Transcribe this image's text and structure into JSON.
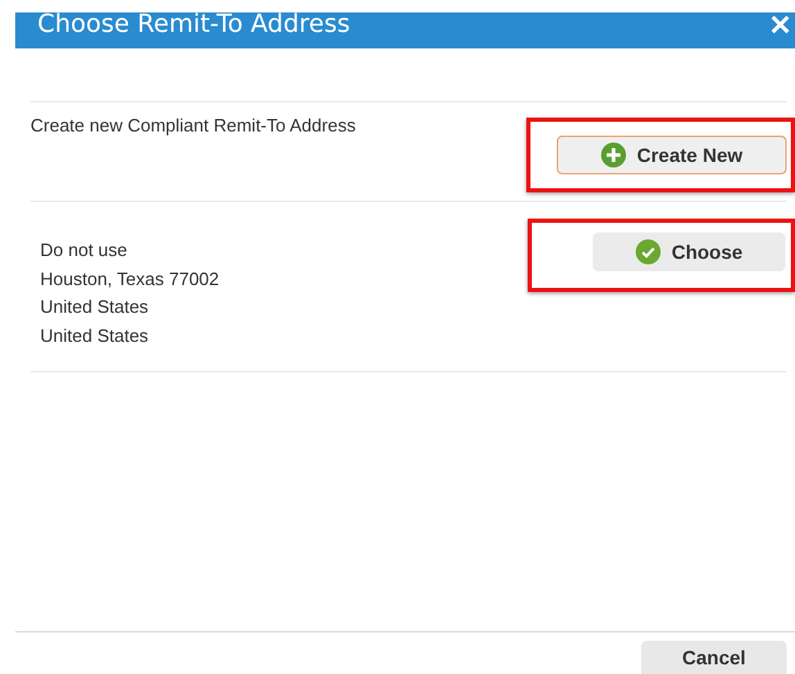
{
  "dialog": {
    "title": "Choose Remit-To Address",
    "close": "✕"
  },
  "create_row": {
    "text": "Create new Compliant Remit-To Address",
    "button": "Create New",
    "highlighted": true
  },
  "addresses": [
    {
      "lines": [
        "Do not use",
        "Houston, Texas 77002",
        "United States",
        "United States"
      ],
      "button": "Choose",
      "highlighted": true
    }
  ],
  "footer": {
    "cancel": "Cancel"
  }
}
